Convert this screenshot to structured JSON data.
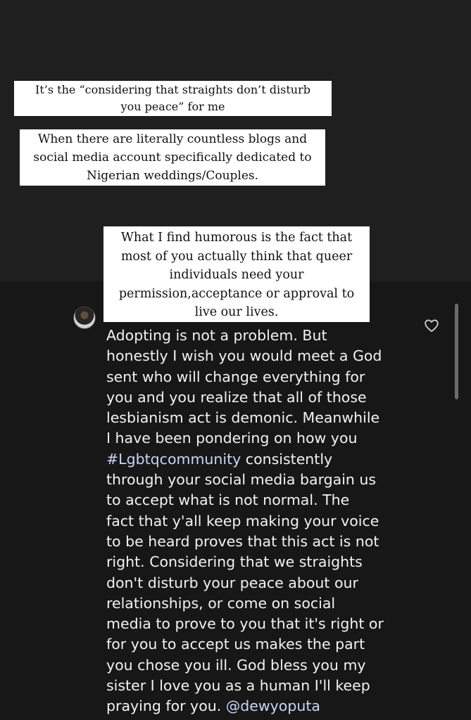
{
  "captions": [
    "It’s the “considering that straights don’t disturb you peace” for me",
    "When there are literally countless blogs and social media account specifically dedicated to Nigerian weddings/Couples.",
    "What I find humorous is the fact that most of you actually think that queer individuals need your permission,acceptance or approval to live our lives."
  ],
  "caption_lines": [
    [
      "It’s the “considering that straights don’t disturb",
      "you peace” for me"
    ],
    [
      "When there are literally countless blogs and",
      "social media account specifically dedicated to",
      "Nigerian weddings/Couples."
    ],
    [
      "What I find humorous is the fact that",
      "most of you actually think that queer",
      "individuals need your",
      "permission,acceptance or approval to",
      "live our lives."
    ]
  ],
  "comment": {
    "lines": [
      "Adopting is not a problem. But",
      "honestly I wish you would meet a God",
      "sent who will change everything for",
      "you and you realize that all of those",
      "lesbianism act is demonic. Meanwhile",
      "I have been pondering on how you",
      "#Lgbtqcommunity consistently",
      "through your social media bargain us",
      "to accept what is not normal. The",
      "fact that y'all keep making your voice",
      "to be heard proves that this act is not",
      "right. Considering that we straights",
      "don't disturb your peace about our",
      "relationships, or come on social",
      "media to prove to you that it's right or",
      "for you to accept us makes the part",
      "you chose you ill. God bless you my",
      "sister I love you as a human I'll keep",
      "praying for you. @dewyoputa"
    ],
    "hashtag": "#Lgbtqcommunity",
    "mention": "@dewyoputa"
  },
  "icons": {
    "like": "heart-outline-icon",
    "avatar": "commenter-avatar"
  },
  "colors": {
    "background": "#1f1f1f",
    "comment_background": "#171717",
    "caption_background": "#ffffff",
    "caption_text": "#111111",
    "comment_text": "#f2f2f2",
    "link_text": "#c8d6f5"
  }
}
